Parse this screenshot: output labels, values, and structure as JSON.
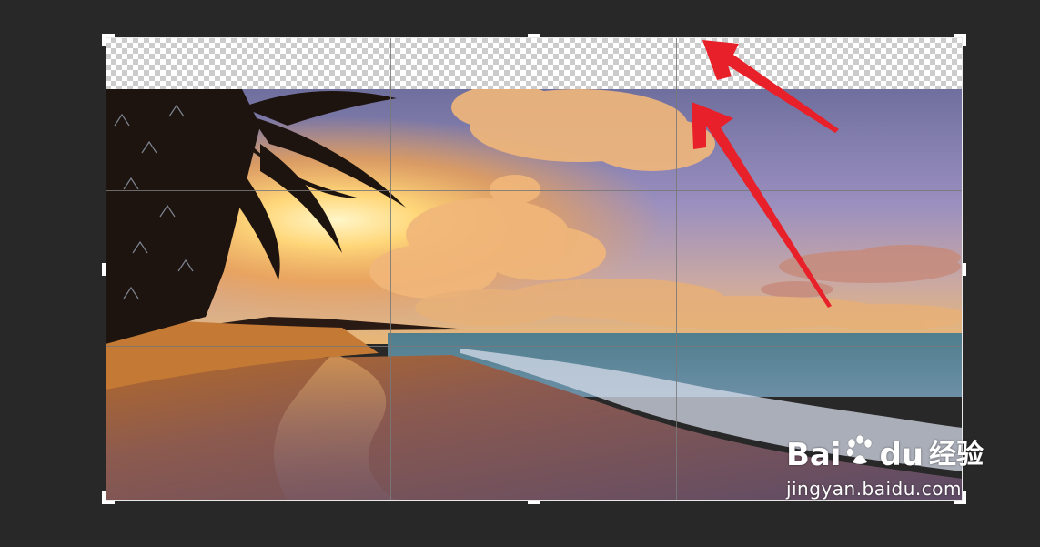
{
  "canvas": {
    "background_color": "#282828"
  },
  "crop_frame": {
    "border_color": "#e8e8e8",
    "grid_color": "#787878",
    "transparent_region": "checkerboard"
  },
  "photo": {
    "subject": "sunset beach with palm tree"
  },
  "annotations": {
    "arrow_color": "#e8202a",
    "arrow_count": 2
  },
  "watermark": {
    "logo_left": "Bai",
    "logo_right": "du",
    "logo_cn": "经验",
    "url": "jingyan.baidu.com"
  }
}
